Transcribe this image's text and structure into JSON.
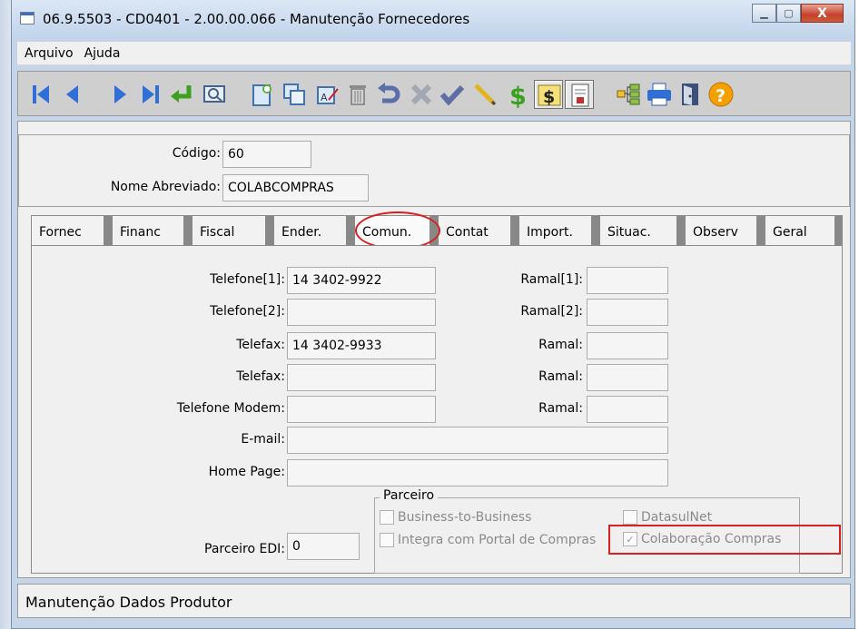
{
  "window": {
    "title": "06.9.5503 - CD0401 - 2.00.00.066 - Manutenção Fornecedores",
    "minimize": "▁",
    "maximize": "▢",
    "close": "X"
  },
  "menu": [
    "Arquivo",
    "Ajuda"
  ],
  "toolbar": {
    "icons": [
      "first-record-icon",
      "previous-record-icon",
      "next-record-icon",
      "last-record-icon",
      "goto-icon",
      "search-icon",
      "add-icon",
      "copy-icon",
      "edit-icon",
      "delete-icon",
      "undo-icon",
      "cancel-icon",
      "confirm-icon",
      "pencil-icon",
      "dollar-icon",
      "currency-button-icon",
      "report-icon",
      "tree-icon",
      "print-icon",
      "exit-icon",
      "help-icon"
    ]
  },
  "header": {
    "codigo_label": "Código:",
    "codigo_value": "60",
    "nome_label": "Nome Abreviado:",
    "nome_value": "COLABCOMPRAS"
  },
  "tabs": [
    "Fornec",
    "Financ",
    "Fiscal",
    "Ender.",
    "Comun.",
    "Contat",
    "Import.",
    "Situac.",
    "Observ",
    "Geral"
  ],
  "active_tab": "Comun.",
  "form": {
    "telefone1_label": "Telefone[1]:",
    "telefone1_value": "14 3402-9922",
    "telefone2_label": "Telefone[2]:",
    "telefone2_value": "",
    "telefax1_label": "Telefax:",
    "telefax1_value": "14 3402-9933",
    "telefax2_label": "Telefax:",
    "telefax2_value": "",
    "modem_label": "Telefone Modem:",
    "modem_value": "",
    "ramal1_label": "Ramal[1]:",
    "ramal2_label": "Ramal[2]:",
    "ramal3_label": "Ramal:",
    "ramal4_label": "Ramal:",
    "ramal5_label": "Ramal:",
    "email_label": "E-mail:",
    "email_value": "",
    "homepage_label": "Home Page:",
    "homepage_value": "",
    "edi_label": "Parceiro EDI:",
    "edi_value": "0"
  },
  "parceiro": {
    "title": "Parceiro",
    "b2b": "Business-to-Business",
    "datasulnet": "DatasulNet",
    "portal": "Integra com Portal de Compras",
    "colaboracao": "Colaboração Compras",
    "check_mark": "✓"
  },
  "status": "Manutenção Dados Produtor"
}
